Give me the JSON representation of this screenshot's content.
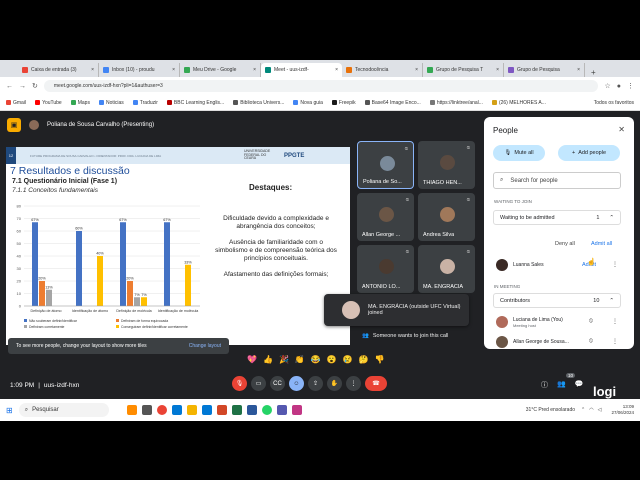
{
  "browser": {
    "tabs": [
      {
        "label": "Caixa de entrada (3)",
        "color": "#ea4335"
      },
      {
        "label": "Inbox (10) - proudu",
        "color": "#4285f4"
      },
      {
        "label": "Meu Drive - Google",
        "color": "#34a853"
      },
      {
        "label": "Meet - uus-izdf-",
        "color": "#00897b",
        "active": true
      },
      {
        "label": "Tecnodocência",
        "color": "#e8710a"
      },
      {
        "label": "Grupo de Pesquisa T",
        "color": "#34a853"
      },
      {
        "label": "Grupo de Pesquisa",
        "color": "#7e57c2"
      }
    ],
    "url": "meet.google.com/uus-izdf-hxn?pli=1&authuser=3",
    "bookmarks": [
      "Gmail",
      "YouTube",
      "Maps",
      "Noticias",
      "Traduzir",
      "BBC Learning Englis...",
      "Biblioteca Univers...",
      "Nova guia",
      "Freepik",
      "Base64 Image Enco...",
      "https://linktree/anal...",
      "(26) MELHORES A..."
    ],
    "all_favorites": "Todos os favoritos"
  },
  "meet": {
    "presenter_label": "Poliana de Sousa Carvalho (Presenting)",
    "code": "uus-izdf-hxn",
    "time": "1:09 PM",
    "layout_banner": "To see more people, change your layout to show more tiles",
    "layout_link": "Change layout",
    "join_message": "Someone wants to join this call",
    "notification": "MA. ENGRÁCIA (outside UFC Virtual) joined",
    "reactions": [
      "💖",
      "👍",
      "🎉",
      "👏",
      "😂",
      "😮",
      "😢",
      "🤔",
      "👎"
    ],
    "participants_count": "10",
    "logo": "logi",
    "tiles": [
      {
        "name": "Poliana de So...",
        "avatar_color": "#7a8a9a"
      },
      {
        "name": "THIAGO HEN...",
        "avatar_color": "#5a4a40"
      },
      {
        "name": "Allan George ...",
        "avatar_color": "#6b5646"
      },
      {
        "name": "Andrea Silva",
        "avatar_color": "#a0785a"
      },
      {
        "name": "ANTONIO LO...",
        "avatar_color": "#4a3a30"
      },
      {
        "name": "MA. ENGRÁCIA",
        "avatar_color": "#c9b2a5"
      }
    ]
  },
  "slide": {
    "number": "12",
    "header_text": "FUTURE PROGRAMA DE SOUSA CARVALHO • ORIENTADOR: PROF. DRA. LUCIANA DE LIMA",
    "university": "UNIVERSIDADE FEDERAL DO CEARÁ",
    "program": "PPGTE",
    "title": "7 Resultados e discussão",
    "subtitle1": "7.1 Questionário Inicial (Fase 1)",
    "subtitle2": "7.1.1 Conceitos fundamentais",
    "highlights_title": "Destaques:",
    "bullets": [
      "Dificuldade devido a complexidade e abrangência dos conceitos;",
      "Ausência de familiaridade com o simbolismo e de compreensão teórica dos princípios conceituais.",
      "Afastamento das definições formais;"
    ]
  },
  "chart_data": {
    "type": "bar",
    "categories": [
      "Definição de átomo",
      "Identificação de átomo",
      "Definição de molécula",
      "Identificação de molécula"
    ],
    "series": [
      {
        "name": "Não souberam definir/identificar",
        "color": "#4472c4",
        "values": [
          67,
          60,
          67,
          67
        ]
      },
      {
        "name": "Definiram de forma equivocada",
        "color": "#ed7d31",
        "values": [
          20,
          0,
          20,
          0
        ]
      },
      {
        "name": "Definiram corretamente",
        "color": "#a5a5a5",
        "values": [
          13,
          0,
          7,
          0
        ]
      },
      {
        "name": "Conseguiram definir/identificar corretamente",
        "color": "#ffc000",
        "values": [
          0,
          40,
          7,
          33
        ]
      }
    ],
    "data_labels": [
      [
        "67%",
        "20%",
        "13%",
        ""
      ],
      [
        "60%",
        "",
        "",
        "40%"
      ],
      [
        "67%",
        "20%",
        "7%",
        "7%"
      ],
      [
        "67%",
        "",
        "",
        "33%"
      ]
    ],
    "y_ticks": [
      "0",
      "10",
      "20",
      "30",
      "40",
      "50",
      "60",
      "70",
      "80"
    ],
    "ylim": [
      0,
      80
    ]
  },
  "panel": {
    "title": "People",
    "mute_all": "Mute all",
    "add_people": "Add people",
    "search_placeholder": "Search for people",
    "waiting_label": "WAITING TO JOIN",
    "waiting_box": "Waiting to be admitted",
    "waiting_count": "1",
    "deny_all": "Deny all",
    "admit_all": "Admit all",
    "waiting_person": "Luanna Sales",
    "admit": "Admit",
    "in_meeting_label": "IN MEETING",
    "contributors": "Contributors",
    "contributors_count": "10",
    "members": [
      {
        "name": "Luciana de Lima (You)",
        "role": "Meeting host",
        "color": "#b06a5a"
      },
      {
        "name": "Allan George de Sousa...",
        "role": "",
        "color": "#6b5646"
      }
    ]
  },
  "taskbar": {
    "search": "Pesquisar",
    "weather": "31°C Pred ensolarado",
    "time": "13:09",
    "date": "27/06/2024"
  }
}
